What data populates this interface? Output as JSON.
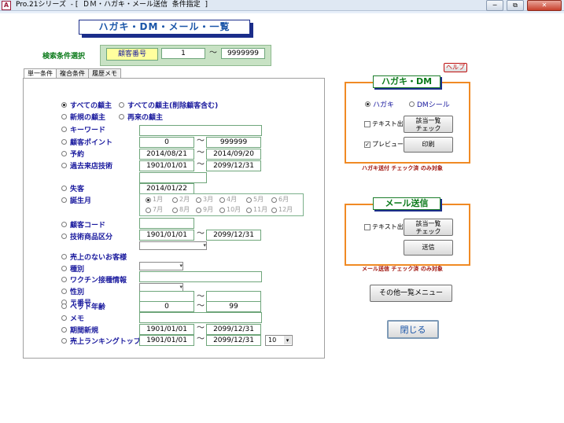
{
  "window": {
    "icon_letter": "A",
    "title": "Pro.21シリーズ  - [  ＤＭ・ハガキ・メール送信  条件指定  ]",
    "min_label": "─",
    "restore_label": "⧉",
    "close_label": "✕"
  },
  "header": {
    "title": "ハガキ・DM・メール・一覧"
  },
  "condition": {
    "label": "検索条件選択",
    "key_label": "顧客番号",
    "from_value": "1",
    "to_value": "9999999",
    "tilde": "〜"
  },
  "help_button": "ヘルプ",
  "tabs": [
    {
      "label": "単一条件"
    },
    {
      "label": "複合条件"
    },
    {
      "label": "履歴メモ"
    }
  ],
  "single": {
    "all_clients": "すべての顧主",
    "all_clients_incl_deleted": "すべての顧主(削除顧客含む)",
    "new_clients": "新規の顧主",
    "returning_clients": "再来の顧主",
    "keyword": "キーワード",
    "points": {
      "label": "顧客ポイント",
      "from": "0",
      "to": "999999"
    },
    "reservation": {
      "label": "予約",
      "from": "2014/08/21",
      "to": "2014/09/20"
    },
    "past_visit": {
      "label": "過去来店技術",
      "from": "1901/01/01",
      "to": "2099/12/31"
    },
    "lost": {
      "label": "失客",
      "date": "2014/01/22"
    },
    "birth_month": {
      "label": "誕生月",
      "months": [
        "1月",
        "2月",
        "3月",
        "4月",
        "5月",
        "6月",
        "7月",
        "8月",
        "9月",
        "10月",
        "11月",
        "12月"
      ]
    },
    "client_code": "顧客コード",
    "tech_item": {
      "label": "技術商品区分",
      "from": "1901/01/01",
      "to": "2099/12/31"
    },
    "no_sales": "売上のないお客様",
    "kind": "種別",
    "vaccine": "ワクチン接種情報",
    "gender": "性別",
    "zip": "〒番号",
    "pet_age": {
      "label": "ペット年齢",
      "from": "0",
      "to": "99"
    },
    "memo": "メモ",
    "period_new": {
      "label": "期間新規",
      "from": "1901/01/01",
      "to": "2099/12/31"
    },
    "sales_rank": {
      "label": "売上ランキングトップ",
      "from": "1901/01/01",
      "to": "2099/12/31",
      "top": "10"
    }
  },
  "hagaki": {
    "title": "ハガキ・DM",
    "opt_hagaki": "ハガキ",
    "opt_dm": "DMシール",
    "text_out": "テキスト出力",
    "preview": "プレビュー",
    "check_btn_1": "該当一覧",
    "check_btn_2": "チェック",
    "print_btn": "印刷",
    "note": "ハガキ送付 チェック済 のみ対象"
  },
  "mail": {
    "title": "メール送信",
    "text_out": "テキスト出力",
    "check_btn_1": "該当一覧",
    "check_btn_2": "チェック",
    "send_btn": "送信",
    "note": "メール送信 チェック済 のみ対象"
  },
  "other_menu": "その他一覧メニュー",
  "close_button": "閉じる"
}
